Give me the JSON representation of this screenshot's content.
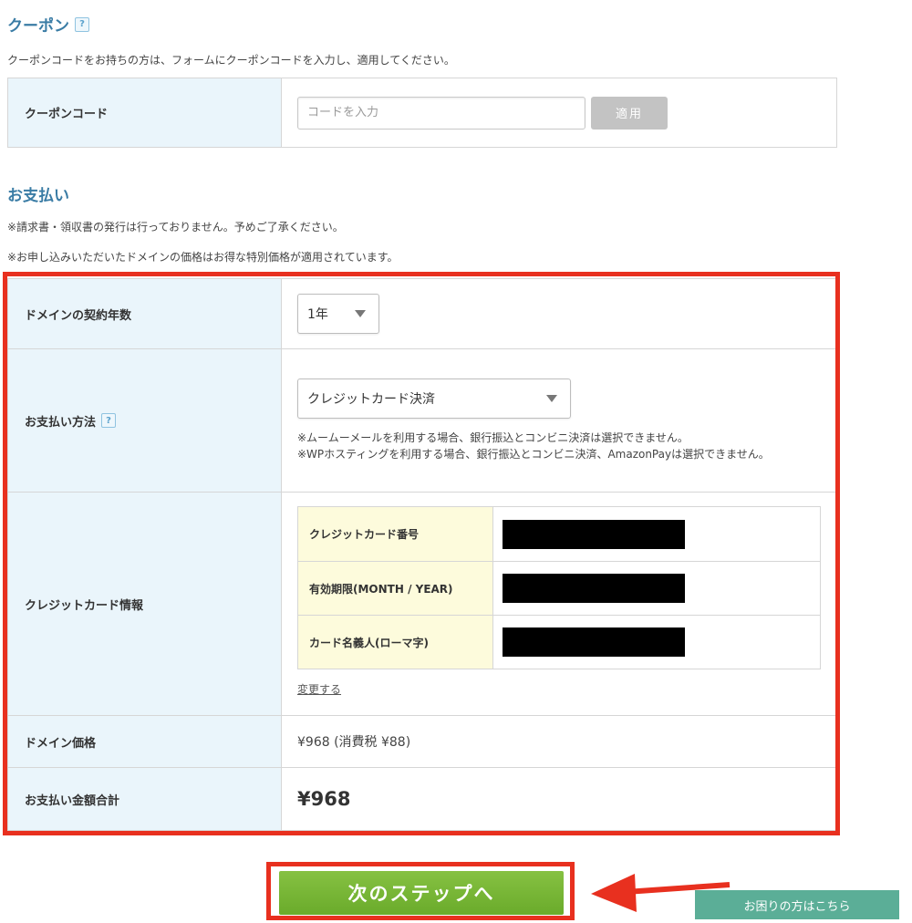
{
  "coupon": {
    "title": "クーポン",
    "help_icon": "?",
    "description": "クーポンコードをお持ちの方は、フォームにクーポンコードを入力し、適用してください。",
    "code_label": "クーポンコード",
    "code_placeholder": "コードを入力",
    "apply_label": "適用"
  },
  "payment": {
    "title": "お支払い",
    "note1": "※請求書・領収書の発行は行っておりません。予めご了承ください。",
    "note2": "※お申し込みいただいたドメインの価格はお得な特別価格が適用されています。",
    "years_label": "ドメインの契約年数",
    "years_value": "1年",
    "method_label": "お支払い方法",
    "method_help_icon": "?",
    "method_value": "クレジットカード決済",
    "method_note1": "※ムームーメールを利用する場合、銀行振込とコンビニ決済は選択できません。",
    "method_note2": "※WPホスティングを利用する場合、銀行振込とコンビニ決済、AmazonPayは選択できません。",
    "card_info_label": "クレジットカード情報",
    "card_fields": [
      {
        "label": "クレジットカード番号"
      },
      {
        "label": "有効期限(MONTH / YEAR)"
      },
      {
        "label": "カード名義人(ローマ字)"
      }
    ],
    "change_link": "変更する",
    "price_label": "ドメイン価格",
    "price_value": "¥968 (消費税 ¥88)",
    "total_label": "お支払い金額合計",
    "total_value": "¥968"
  },
  "actions": {
    "next_label": "次のステップへ",
    "help_label": "お困りの方はこちら"
  },
  "colors": {
    "accent_title": "#3a7ca5",
    "label_bg": "#eaf5fb",
    "card_label_bg": "#fdfbdc",
    "highlight": "#e8301f",
    "next_button": "#78b536",
    "help_tab": "#5bae97"
  }
}
